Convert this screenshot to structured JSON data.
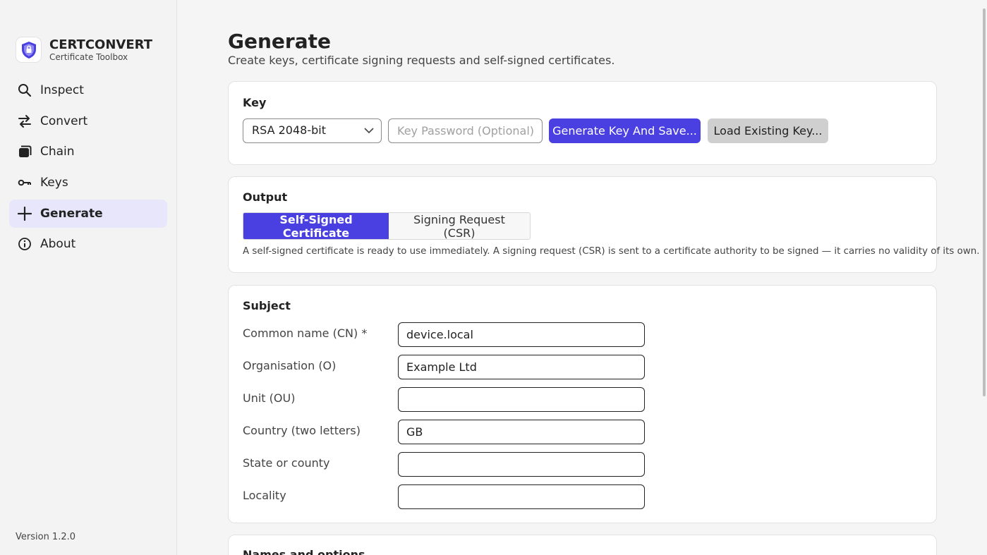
{
  "app": {
    "name": "CERTCONVERT",
    "subtitle": "Certificate Toolbox",
    "version": "Version 1.2.0"
  },
  "sidebar": {
    "items": [
      {
        "label": "Inspect",
        "icon": "search-icon"
      },
      {
        "label": "Convert",
        "icon": "swap-arrows-icon"
      },
      {
        "label": "Chain",
        "icon": "stack-icon"
      },
      {
        "label": "Keys",
        "icon": "key-icon"
      },
      {
        "label": "Generate",
        "icon": "plus-icon",
        "active": true
      },
      {
        "label": "About",
        "icon": "info-icon"
      }
    ]
  },
  "page": {
    "title": "Generate",
    "subtitle": "Create keys, certificate signing requests and self-signed certificates."
  },
  "key_card": {
    "title": "Key",
    "key_type_value": "RSA 2048-bit",
    "password_placeholder": "Key Password (Optional)",
    "generate_button": "Generate Key And Save...",
    "load_button": "Load Existing Key..."
  },
  "output_card": {
    "title": "Output",
    "tabs": [
      {
        "label": "Self-Signed Certificate",
        "selected": true
      },
      {
        "label": "Signing Request (CSR)",
        "selected": false
      }
    ],
    "description": "A self-signed certificate is ready to use immediately. A signing request (CSR) is sent to a certificate authority to be signed — it carries no validity of its own."
  },
  "subject_card": {
    "title": "Subject",
    "fields": [
      {
        "label": "Common name (CN) *",
        "value": "device.local"
      },
      {
        "label": "Organisation (O)",
        "value": "Example Ltd"
      },
      {
        "label": "Unit (OU)",
        "value": ""
      },
      {
        "label": "Country (two letters)",
        "value": "GB"
      },
      {
        "label": "State or county",
        "value": ""
      },
      {
        "label": "Locality",
        "value": ""
      }
    ]
  },
  "names_card": {
    "title": "Names and options"
  },
  "colors": {
    "accent": "#4a3fe0",
    "active_nav_bg": "#e8e6fb",
    "secondary_button": "#cfcfcf"
  }
}
